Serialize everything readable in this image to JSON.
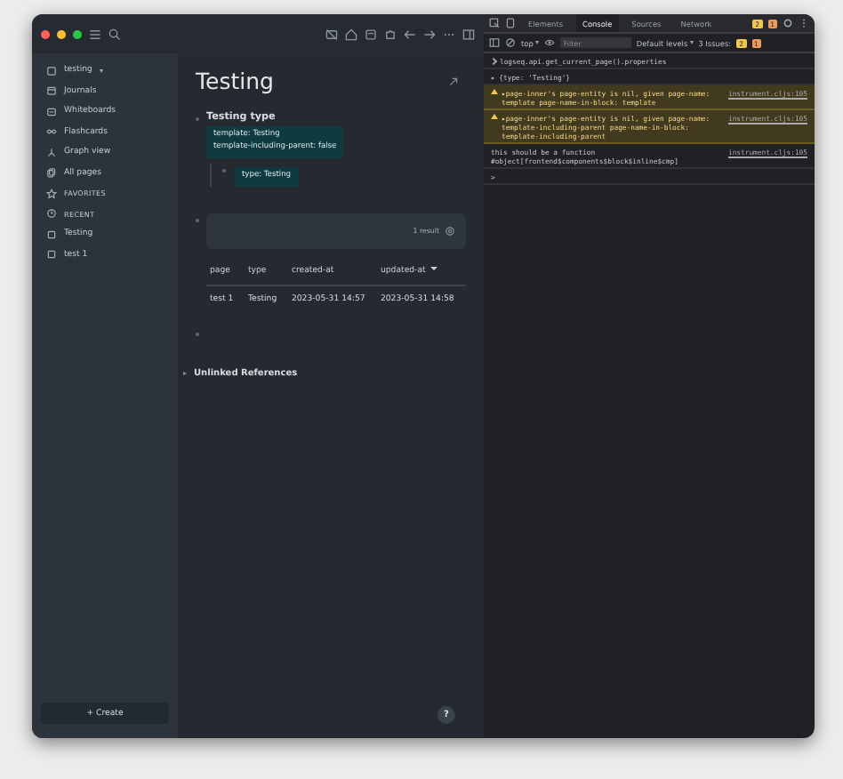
{
  "sidebar": {
    "graph": "testing",
    "nav": [
      {
        "kind": "journals",
        "label": "Journals"
      },
      {
        "kind": "whiteboards",
        "label": "Whiteboards"
      },
      {
        "kind": "flashcards",
        "label": "Flashcards"
      },
      {
        "kind": "graph",
        "label": "Graph view"
      },
      {
        "kind": "pages",
        "label": "All pages"
      }
    ],
    "favorites": "FAVORITES",
    "recent_heading": "RECENT",
    "recent": [
      "Testing",
      "test 1"
    ],
    "create": "+ Create"
  },
  "page": {
    "title": "Testing",
    "block": {
      "text": "Testing type",
      "properties": [
        "template: Testing",
        "template-including-parent: false"
      ],
      "child_properties": [
        "type: Testing"
      ]
    },
    "query": {
      "result_count": "1 result",
      "columns": [
        {
          "label": "page",
          "sorted": false
        },
        {
          "label": "type",
          "sorted": false
        },
        {
          "label": "created-at",
          "sorted": false
        },
        {
          "label": "updated-at",
          "sorted": true
        }
      ],
      "rows": [
        [
          "test 1",
          "Testing",
          "2023-05-31 14:57",
          "2023-05-31 14:58"
        ]
      ]
    },
    "unlinked": "Unlinked References",
    "help": "?"
  },
  "devtools": {
    "tabs": [
      {
        "label": "Elements",
        "selected": false
      },
      {
        "label": "Console",
        "selected": true
      },
      {
        "label": "Sources",
        "selected": false
      },
      {
        "label": "Network",
        "selected": false
      }
    ],
    "tab_badges": [
      {
        "kind": "warning",
        "count": "2"
      },
      {
        "kind": "info",
        "count": "1"
      }
    ],
    "context": "top",
    "filter_placeholder": "Filter",
    "levels": "Default levels",
    "issues": "3 Issues:",
    "issue_counts": [
      {
        "kind": "warning",
        "count": "2"
      },
      {
        "kind": "info",
        "count": "1"
      }
    ],
    "console": [
      {
        "kind": "input",
        "text": "logseq.api.get_current_page().properties"
      },
      {
        "kind": "output",
        "text": "▸ {type: 'Testing'}"
      },
      {
        "kind": "warning",
        "text": "▸page-inner's page-entity is nil, given page-name: template  page-name-in-block: template",
        "source": "instrument.cljs:105"
      },
      {
        "kind": "warning",
        "text": "▸page-inner's page-entity is nil, given page-name: template-including-parent  page-name-in-block: template-including-parent",
        "source": "instrument.cljs:105"
      },
      {
        "kind": "log",
        "text": "this should be a function #object[frontend$components$block$inline$cmp]",
        "source": "instrument.cljs:105"
      },
      {
        "kind": "prompt",
        "text": ">"
      }
    ]
  }
}
